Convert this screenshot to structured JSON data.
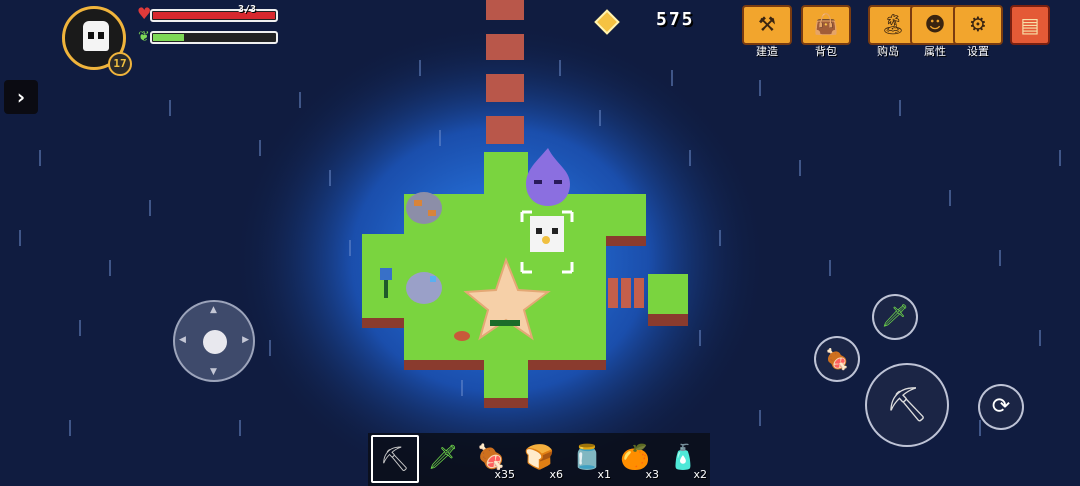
{
  "player": {
    "level": "17",
    "hp_text": "3/3",
    "hp_fraction": 1.0,
    "energy_fraction": 0.25
  },
  "coins": {
    "count": "575",
    "icon": "coin-icon"
  },
  "menu": {
    "build": {
      "label": "建造",
      "icon": "hammer-icon"
    },
    "backpack": {
      "label": "背包",
      "icon": "bag-icon"
    },
    "buy_island": {
      "label": "购岛",
      "icon": "island-icon"
    },
    "attributes": {
      "label": "属性",
      "icon": "stats-icon"
    },
    "settings": {
      "label": "设置",
      "icon": "gear-icon"
    },
    "map": {
      "icon": "map-icon"
    }
  },
  "controls": {
    "expand_icon": "chevron-right-icon",
    "attack_icon": "pickaxe-icon",
    "weapon_icon": "sword-icon",
    "food_icon": "meat-icon",
    "roll_icon": "dodge-roll-icon"
  },
  "hotbar": [
    {
      "icon": "pickaxe-icon",
      "glyph": "⛏",
      "count": "",
      "selected": true,
      "color": "#c9c9c9"
    },
    {
      "icon": "sword-icon",
      "glyph": "🗡",
      "count": "",
      "selected": false,
      "color": "#6fd84a"
    },
    {
      "icon": "meat-icon",
      "glyph": "🍖",
      "count": "x35",
      "selected": false,
      "color": "#c8703a"
    },
    {
      "icon": "bread-icon",
      "glyph": "🍞",
      "count": "x6",
      "selected": false,
      "color": "#f1d78a"
    },
    {
      "icon": "empty-bottle-icon",
      "glyph": "🫙",
      "count": "x1",
      "selected": false,
      "color": "#dddddd"
    },
    {
      "icon": "orange-icon",
      "glyph": "🍊",
      "count": "x3",
      "selected": false,
      "color": "#f29a2e"
    },
    {
      "icon": "water-bottle-icon",
      "glyph": "🧴",
      "count": "x2",
      "selected": false,
      "color": "#5aa8ff"
    }
  ],
  "colors": {
    "night_sky": "#0f1b3d",
    "glow": "#1f6fe0",
    "grass": "#78d13e",
    "hud_orange": "#f2a52d"
  }
}
